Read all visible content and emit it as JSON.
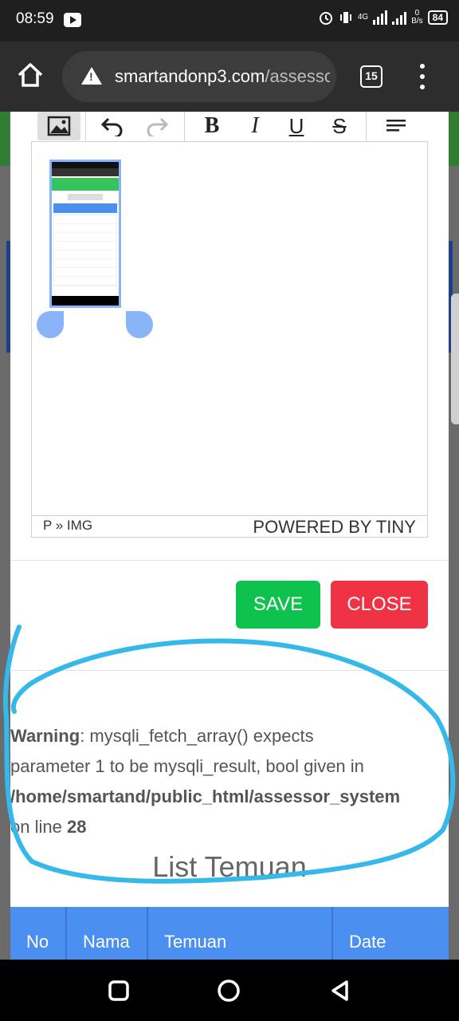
{
  "status_bar": {
    "time": "08:59",
    "network_speed_value": "0",
    "network_speed_unit": "B/s",
    "battery": "84",
    "network_type": "4G"
  },
  "browser": {
    "url_host": "smartandonp3.com",
    "url_path": "/assesso",
    "tab_count": "15"
  },
  "editor": {
    "toolbar": {
      "bold": "B",
      "italic": "I",
      "underline": "U",
      "strike": "S"
    },
    "path": "P » IMG",
    "powered_by": "POWERED BY TINY"
  },
  "actions": {
    "save": "SAVE",
    "close": "CLOSE"
  },
  "warning": {
    "label": "Warning",
    "message_1": ": mysqli_fetch_array() expects",
    "message_2": "parameter 1 to be mysqli_result, bool given in",
    "path": "/home/smartand/public_html/assessor_system",
    "line_prefix": "on line ",
    "line_number": "28"
  },
  "list": {
    "title": "List Temuan",
    "columns": [
      "No",
      "Nama",
      "Temuan",
      "Date"
    ]
  },
  "colors": {
    "save": "#0fc24e",
    "close": "#f03245",
    "table_header": "#4b8ff0",
    "annotation": "#36b8ea"
  }
}
